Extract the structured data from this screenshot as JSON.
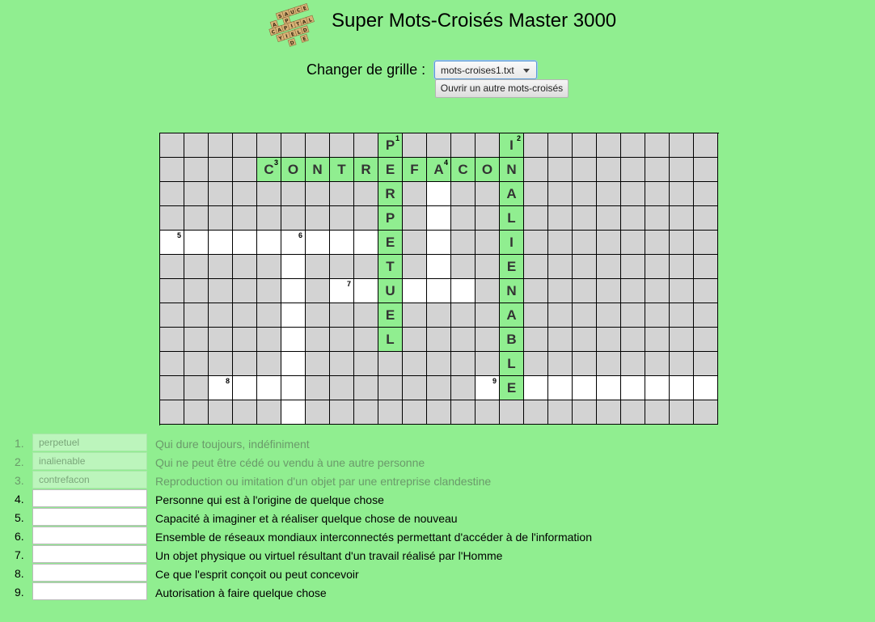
{
  "app": {
    "title": "Super Mots-Croisés Master 3000",
    "logo_tiles": [
      "S",
      "A",
      "U",
      "C",
      "E",
      "A",
      "P",
      "C",
      "A",
      "P",
      "I",
      "T",
      "A",
      "L",
      "Y",
      "I",
      "E",
      "L",
      "D",
      "D",
      "E"
    ]
  },
  "controls": {
    "grid_label": "Changer de grille :",
    "grid_select_value": "mots-croises1.txt",
    "open_button_label": "Ouvrir un autre mots-croisés"
  },
  "colors": {
    "background": "#90ee90",
    "empty_cell": "#d3d3d3",
    "active_cell": "#ffffff",
    "solved_cell": "#90ee90",
    "solved_input": "#bcf5bc"
  },
  "grid": {
    "rows": 12,
    "cols": 23,
    "cells": [
      {
        "r": 0,
        "c": 9,
        "s": "solved",
        "l": "P",
        "n": "1"
      },
      {
        "r": 0,
        "c": 14,
        "s": "solved",
        "l": "I",
        "n": "2"
      },
      {
        "r": 1,
        "c": 4,
        "s": "solved",
        "l": "C",
        "n": "3"
      },
      {
        "r": 1,
        "c": 5,
        "s": "solved",
        "l": "O"
      },
      {
        "r": 1,
        "c": 6,
        "s": "solved",
        "l": "N"
      },
      {
        "r": 1,
        "c": 7,
        "s": "solved",
        "l": "T"
      },
      {
        "r": 1,
        "c": 8,
        "s": "solved",
        "l": "R"
      },
      {
        "r": 1,
        "c": 9,
        "s": "solved",
        "l": "E"
      },
      {
        "r": 1,
        "c": 10,
        "s": "solved",
        "l": "F"
      },
      {
        "r": 1,
        "c": 11,
        "s": "solved",
        "l": "A",
        "n": "4"
      },
      {
        "r": 1,
        "c": 12,
        "s": "solved",
        "l": "C"
      },
      {
        "r": 1,
        "c": 13,
        "s": "solved",
        "l": "O"
      },
      {
        "r": 1,
        "c": 14,
        "s": "solved",
        "l": "N"
      },
      {
        "r": 2,
        "c": 9,
        "s": "solved",
        "l": "R"
      },
      {
        "r": 2,
        "c": 11,
        "s": "active"
      },
      {
        "r": 2,
        "c": 14,
        "s": "solved",
        "l": "A"
      },
      {
        "r": 3,
        "c": 9,
        "s": "solved",
        "l": "P"
      },
      {
        "r": 3,
        "c": 11,
        "s": "active"
      },
      {
        "r": 3,
        "c": 14,
        "s": "solved",
        "l": "L"
      },
      {
        "r": 4,
        "c": 0,
        "s": "active",
        "n": "5"
      },
      {
        "r": 4,
        "c": 1,
        "s": "active"
      },
      {
        "r": 4,
        "c": 2,
        "s": "active"
      },
      {
        "r": 4,
        "c": 3,
        "s": "active"
      },
      {
        "r": 4,
        "c": 4,
        "s": "active"
      },
      {
        "r": 4,
        "c": 5,
        "s": "active",
        "n": "6"
      },
      {
        "r": 4,
        "c": 6,
        "s": "active"
      },
      {
        "r": 4,
        "c": 7,
        "s": "active"
      },
      {
        "r": 4,
        "c": 8,
        "s": "active"
      },
      {
        "r": 4,
        "c": 9,
        "s": "solved",
        "l": "E"
      },
      {
        "r": 4,
        "c": 11,
        "s": "active"
      },
      {
        "r": 4,
        "c": 14,
        "s": "solved",
        "l": "I"
      },
      {
        "r": 5,
        "c": 5,
        "s": "active"
      },
      {
        "r": 5,
        "c": 9,
        "s": "solved",
        "l": "T"
      },
      {
        "r": 5,
        "c": 11,
        "s": "active"
      },
      {
        "r": 5,
        "c": 14,
        "s": "solved",
        "l": "E"
      },
      {
        "r": 6,
        "c": 5,
        "s": "active"
      },
      {
        "r": 6,
        "c": 7,
        "s": "active",
        "n": "7"
      },
      {
        "r": 6,
        "c": 8,
        "s": "active"
      },
      {
        "r": 6,
        "c": 9,
        "s": "solved",
        "l": "U"
      },
      {
        "r": 6,
        "c": 10,
        "s": "active"
      },
      {
        "r": 6,
        "c": 11,
        "s": "active"
      },
      {
        "r": 6,
        "c": 12,
        "s": "active"
      },
      {
        "r": 6,
        "c": 14,
        "s": "solved",
        "l": "N"
      },
      {
        "r": 7,
        "c": 5,
        "s": "active"
      },
      {
        "r": 7,
        "c": 9,
        "s": "solved",
        "l": "E"
      },
      {
        "r": 7,
        "c": 14,
        "s": "solved",
        "l": "A"
      },
      {
        "r": 8,
        "c": 5,
        "s": "active"
      },
      {
        "r": 8,
        "c": 9,
        "s": "solved",
        "l": "L"
      },
      {
        "r": 8,
        "c": 14,
        "s": "solved",
        "l": "B"
      },
      {
        "r": 9,
        "c": 5,
        "s": "active"
      },
      {
        "r": 9,
        "c": 14,
        "s": "solved",
        "l": "L"
      },
      {
        "r": 10,
        "c": 2,
        "s": "active",
        "n": "8"
      },
      {
        "r": 10,
        "c": 3,
        "s": "active"
      },
      {
        "r": 10,
        "c": 4,
        "s": "active"
      },
      {
        "r": 10,
        "c": 5,
        "s": "active"
      },
      {
        "r": 10,
        "c": 13,
        "s": "active",
        "n": "9"
      },
      {
        "r": 10,
        "c": 14,
        "s": "solved",
        "l": "E"
      },
      {
        "r": 10,
        "c": 15,
        "s": "active"
      },
      {
        "r": 10,
        "c": 16,
        "s": "active"
      },
      {
        "r": 10,
        "c": 17,
        "s": "active"
      },
      {
        "r": 10,
        "c": 18,
        "s": "active"
      },
      {
        "r": 10,
        "c": 19,
        "s": "active"
      },
      {
        "r": 10,
        "c": 20,
        "s": "active"
      },
      {
        "r": 10,
        "c": 21,
        "s": "active"
      },
      {
        "r": 10,
        "c": 22,
        "s": "active"
      },
      {
        "r": 11,
        "c": 5,
        "s": "active"
      }
    ]
  },
  "clues": [
    {
      "num": "1.",
      "answer": "perpetuel",
      "text": "Qui dure toujours, indéfiniment",
      "solved": true
    },
    {
      "num": "2.",
      "answer": "inalienable",
      "text": "Qui ne peut être cédé ou vendu à une autre personne",
      "solved": true
    },
    {
      "num": "3.",
      "answer": "contrefacon",
      "text": "Reproduction ou imitation d'un objet par une entreprise clandestine",
      "solved": true
    },
    {
      "num": "4.",
      "answer": "",
      "text": "Personne qui est à l'origine de quelque chose",
      "solved": false
    },
    {
      "num": "5.",
      "answer": "",
      "text": "Capacité à imaginer et à réaliser quelque chose de nouveau",
      "solved": false
    },
    {
      "num": "6.",
      "answer": "",
      "text": "Ensemble de réseaux mondiaux interconnectés permettant d'accéder à de l'information",
      "solved": false
    },
    {
      "num": "7.",
      "answer": "",
      "text": "Un objet physique ou virtuel résultant d'un travail réalisé par l'Homme",
      "solved": false
    },
    {
      "num": "8.",
      "answer": "",
      "text": "Ce que l'esprit conçoit ou peut concevoir",
      "solved": false
    },
    {
      "num": "9.",
      "answer": "",
      "text": "Autorisation à faire quelque chose",
      "solved": false
    }
  ]
}
